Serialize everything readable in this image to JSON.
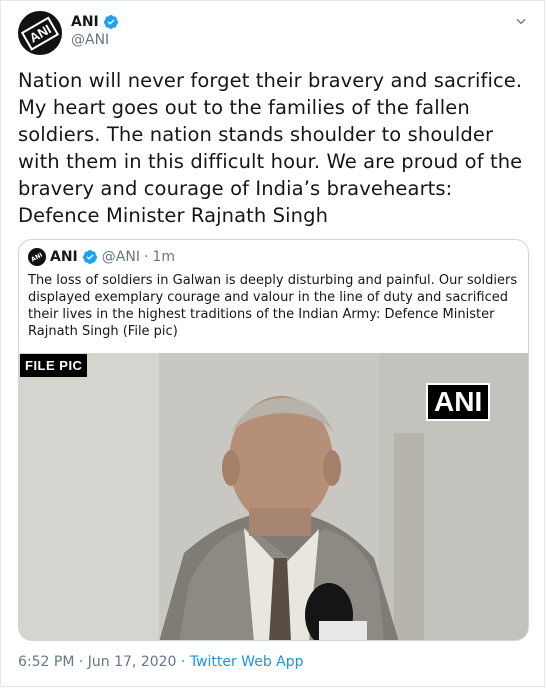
{
  "tweet": {
    "author_name": "ANI",
    "author_handle": "@ANI",
    "avatar_text": "ANI",
    "text": "Nation will never forget their bravery and sacrifice. My heart goes out to the families of the fallen soldiers. The nation stands shoulder to shoulder with them in this difficult hour. We are proud of the bravery and courage of India’s bravehearts: Defence Minister Rajnath Singh",
    "time": "6:52 PM",
    "separator": "·",
    "date": "Jun 17, 2020",
    "app": "Twitter Web App"
  },
  "quoted": {
    "author_name": "ANI",
    "author_handle": "@ANI",
    "separator": "·",
    "age": "1m",
    "text": "The loss of soldiers in Galwan is deeply disturbing and painful. Our soldiers displayed exemplary courage and valour in the line of duty and sacrificed their lives in the highest traditions of the Indian Army: Defence Minister Rajnath Singh (File pic)",
    "media_label": "FILE PIC",
    "media_watermark": "ANI"
  },
  "colors": {
    "verified": "#1da1f2",
    "link": "#1b95e0",
    "muted": "#657786"
  },
  "icons": [
    "verified-badge-icon",
    "chevron-down-icon"
  ]
}
